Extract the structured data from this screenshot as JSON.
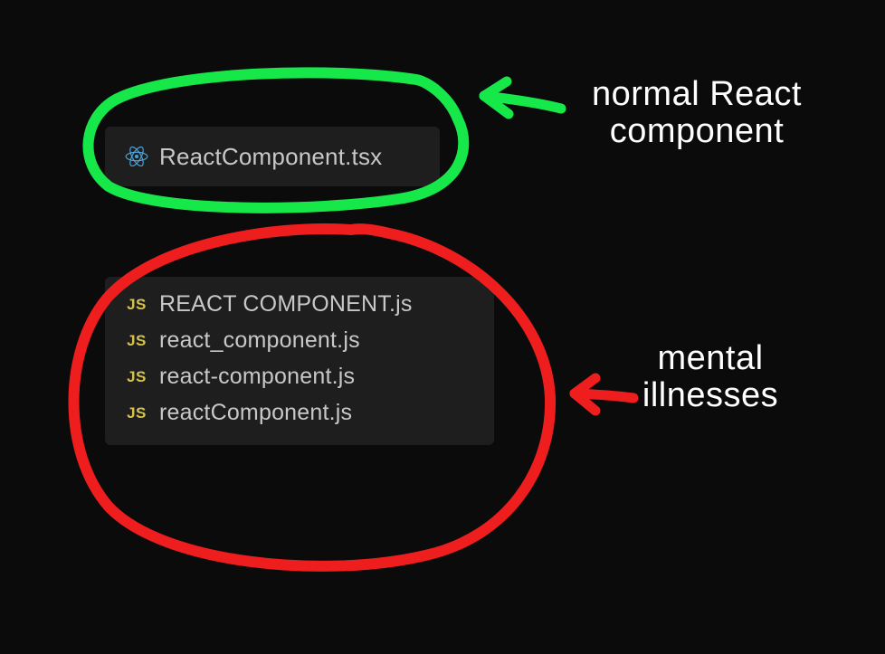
{
  "colors": {
    "green": "#17e84a",
    "red": "#ef1e1e",
    "react_blue": "#4aa3d8",
    "js_yellow": "#d6c24a",
    "filename_gray": "#c8c8c8"
  },
  "icons": {
    "react": "react-icon",
    "js": "JS"
  },
  "good": {
    "files": [
      {
        "icon": "react",
        "name": "ReactComponent.tsx"
      }
    ]
  },
  "bad": {
    "files": [
      {
        "icon": "js",
        "name": "REACT COMPONENT.js"
      },
      {
        "icon": "js",
        "name": "react_component.js"
      },
      {
        "icon": "js",
        "name": "react-component.js"
      },
      {
        "icon": "js",
        "name": "reactComponent.js"
      }
    ]
  },
  "labels": {
    "top_line1": "normal React",
    "top_line2": "component",
    "bottom_line1": "mental",
    "bottom_line2": "illnesses"
  }
}
